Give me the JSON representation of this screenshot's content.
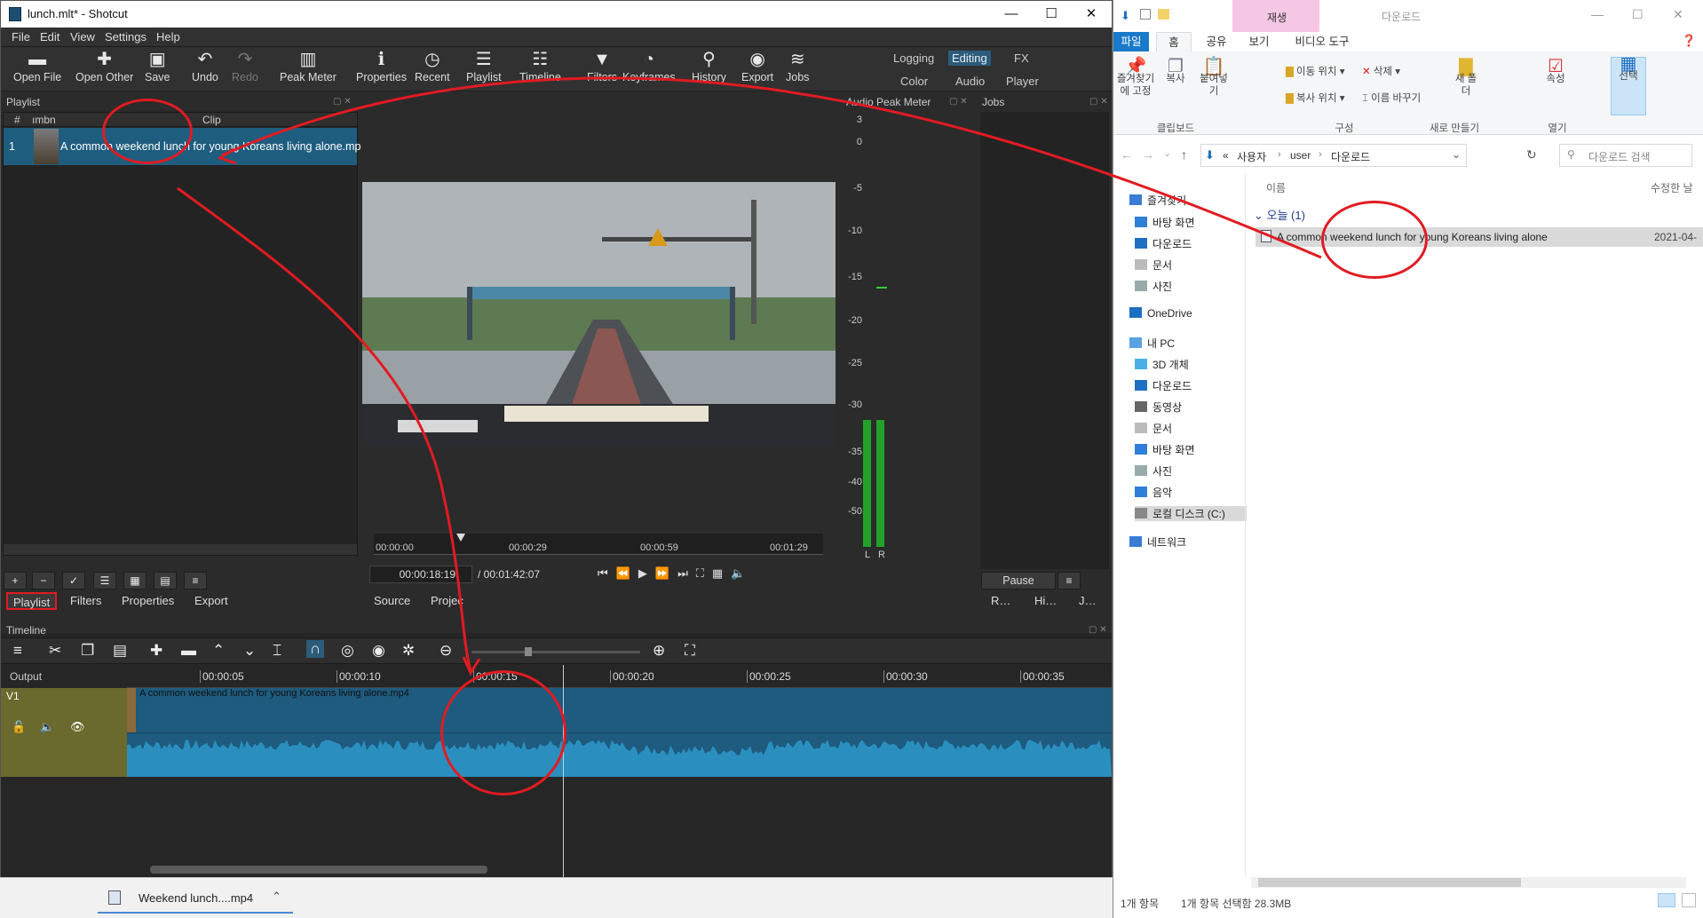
{
  "shotcut": {
    "window_title": "lunch.mlt* - Shotcut",
    "menu": [
      "File",
      "Edit",
      "View",
      "Settings",
      "Help"
    ],
    "toolbar": [
      {
        "label": "Open File",
        "icon": "open-file-icon",
        "glyph": "▬"
      },
      {
        "label": "Open Other",
        "icon": "open-other-icon",
        "glyph": "✚"
      },
      {
        "label": "Save",
        "icon": "save-icon",
        "glyph": "▣"
      },
      {
        "label": "Undo",
        "icon": "undo-icon",
        "glyph": "↶"
      },
      {
        "label": "Redo",
        "icon": "redo-icon",
        "glyph": "↷",
        "disabled": true
      },
      {
        "label": "Peak Meter",
        "icon": "peak-meter-icon",
        "glyph": "▥"
      },
      {
        "label": "Properties",
        "icon": "properties-icon",
        "glyph": "ℹ"
      },
      {
        "label": "Recent",
        "icon": "recent-icon",
        "glyph": "◷"
      },
      {
        "label": "Playlist",
        "icon": "playlist-icon",
        "glyph": "☰"
      },
      {
        "label": "Timeline",
        "icon": "timeline-icon",
        "glyph": "☷"
      },
      {
        "label": "Filters",
        "icon": "filters-icon",
        "glyph": "▼"
      },
      {
        "label": "Keyframes",
        "icon": "keyframes-icon",
        "glyph": "◔"
      },
      {
        "label": "History",
        "icon": "history-icon",
        "glyph": "⚲"
      },
      {
        "label": "Export",
        "icon": "export-icon",
        "glyph": "◉"
      },
      {
        "label": "Jobs",
        "icon": "jobs-icon",
        "glyph": "≋"
      }
    ],
    "workspaces_top": [
      "Logging",
      "Editing",
      "FX"
    ],
    "workspaces_bottom": [
      "Color",
      "Audio",
      "Player"
    ],
    "active_workspace": "Editing",
    "playlist": {
      "title": "Playlist",
      "columns": [
        "#",
        "ımbn",
        "Clip"
      ],
      "rows": [
        {
          "num": "1",
          "clip": "A common weekend lunch for young Koreans living alone.mp"
        }
      ],
      "tabs": [
        "Playlist",
        "Filters",
        "Properties",
        "Export"
      ]
    },
    "audio_meter": {
      "title": "Audio Peak Meter",
      "scale": [
        "3",
        "0",
        "-5",
        "-10",
        "-15",
        "-20",
        "-25",
        "-30",
        "-35",
        "-40",
        "-50"
      ],
      "channels": [
        "L",
        "R"
      ]
    },
    "jobs": {
      "title": "Jobs",
      "pause": "Pause",
      "tabs": [
        "R…",
        "Hi…",
        "J…"
      ]
    },
    "player": {
      "ruler": [
        "00:00:00",
        "00:00:29",
        "00:00:59",
        "00:01:29"
      ],
      "position": "00:00:18:19",
      "duration": "/ 00:01:42:07",
      "tabs": [
        "Source",
        "Projec"
      ]
    },
    "timeline": {
      "title": "Timeline",
      "output": "Output",
      "track": "V1",
      "clip": "A common weekend lunch for young Koreans living alone.mp4",
      "ruler": [
        "00:00:05",
        "00:00:10",
        "00:00:15",
        "00:00:20",
        "00:00:25",
        "00:00:30",
        "00:00:35"
      ]
    }
  },
  "taskbar": {
    "item": "Weekend lunch....mp4"
  },
  "explorer": {
    "context_tab_group": "재생",
    "window_title": "다운로드",
    "ribbon_tabs": [
      "파일",
      "홈",
      "공유",
      "보기",
      "비디오 도구"
    ],
    "ribbon_groups": [
      "클립보드",
      "구성",
      "새로 만들기",
      "열기"
    ],
    "ribbon_items": {
      "pin": "즐겨찾기에 고정",
      "copy": "복사",
      "paste": "붙여넣기",
      "move_to": "이동 위치",
      "copy_to": "복사 위치",
      "delete": "삭제",
      "rename": "이름 바꾸기",
      "new_folder": "새 폴더",
      "properties": "속성",
      "select": "선택"
    },
    "breadcrumb": [
      "«",
      "사용자",
      "user",
      "다운로드"
    ],
    "search_placeholder": "다운로드 검색",
    "column_name": "이름",
    "column_modified": "수정한 날",
    "group": "오늘 (1)",
    "file": {
      "name": "A common weekend lunch for young Koreans living alone",
      "date": "2021-04-"
    },
    "nav": {
      "quick": "즐겨찾기",
      "quick_items": [
        "바탕 화면",
        "다운로드",
        "문서",
        "사진"
      ],
      "onedrive": "OneDrive",
      "pc": "내 PC",
      "pc_items": [
        "3D 개체",
        "다운로드",
        "동영상",
        "문서",
        "바탕 화면",
        "사진",
        "음악",
        "로컬 디스크 (C:)"
      ],
      "network": "네트워크"
    },
    "status_count": "1개 항목",
    "status_selected": "1개 항목 선택함 28.3MB"
  },
  "colors": {
    "accent": "#1f5d7e",
    "annotation": "#e11b22",
    "track_head": "#6a6a2e"
  }
}
